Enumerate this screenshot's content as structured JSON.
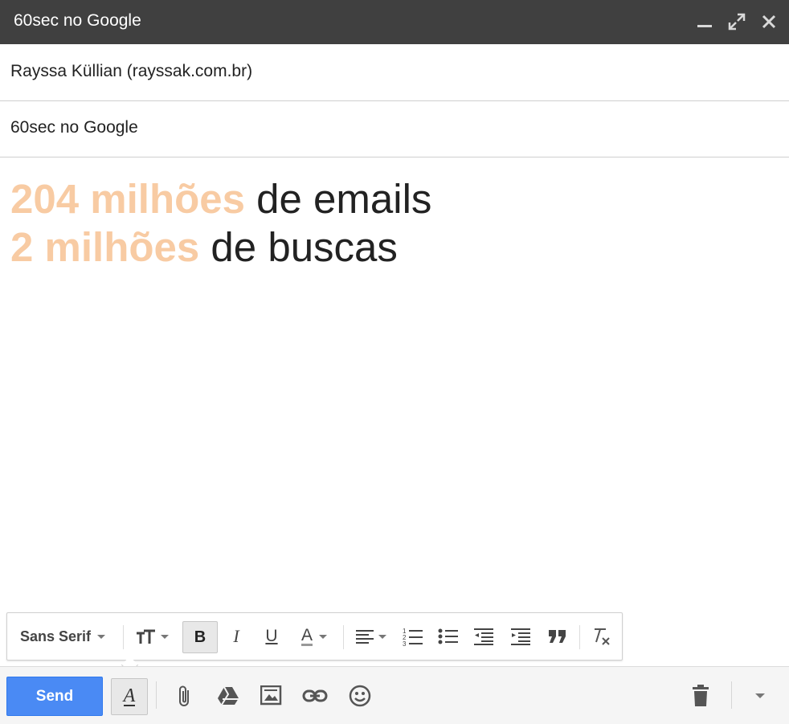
{
  "window": {
    "title": "60sec no Google",
    "controls": [
      "minimize-icon",
      "expand-icon",
      "close-icon"
    ]
  },
  "compose": {
    "to": "Rayssa Küllian (rayssak.com.br)",
    "subject": "60sec no Google",
    "body": {
      "line1": {
        "highlight": "204 milhões",
        "rest": " de emails"
      },
      "line2": {
        "highlight": "2 milhões",
        "rest": " de buscas"
      }
    }
  },
  "format_toolbar": {
    "font_family": "Sans Serif",
    "bold_label": "B",
    "italic_label": "I",
    "underline_label": "U",
    "text_color_label": "A",
    "numbered_list_label": "123"
  },
  "actions": {
    "send_label": "Send",
    "formatting_label": "A"
  },
  "colors": {
    "titlebar": "#404040",
    "highlight": "#f8cba3",
    "send_button": "#4a8af4"
  }
}
